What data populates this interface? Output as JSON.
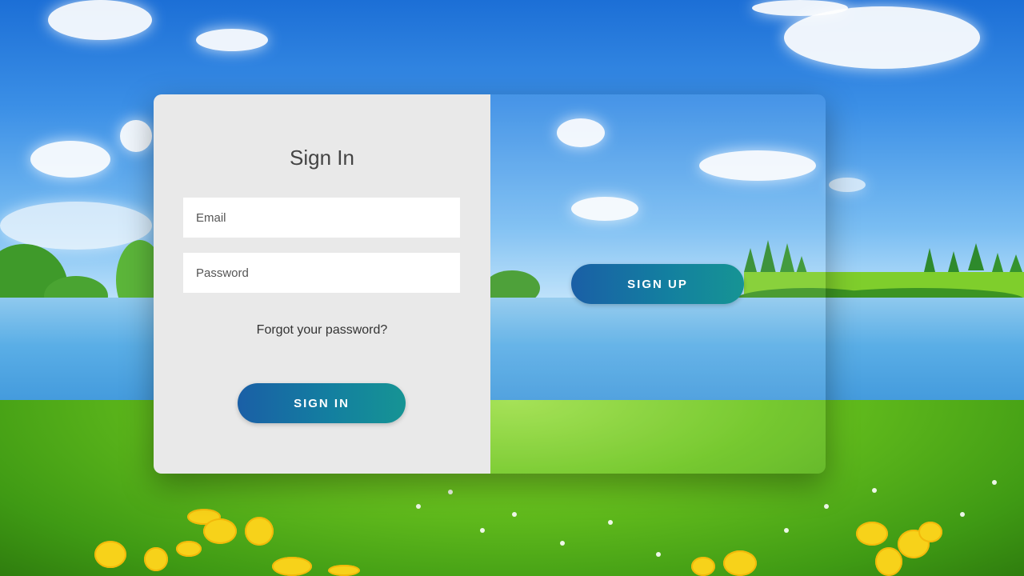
{
  "signin": {
    "title": "Sign In",
    "email_placeholder": "Email",
    "password_placeholder": "Password",
    "forgot_label": "Forgot your password?",
    "button_label": "SIGN IN"
  },
  "overlay": {
    "signup_label": "SIGN UP"
  },
  "colors": {
    "button_gradient_start": "#1a5fa6",
    "button_gradient_end": "#169494",
    "panel_background": "#e9e9e9"
  }
}
